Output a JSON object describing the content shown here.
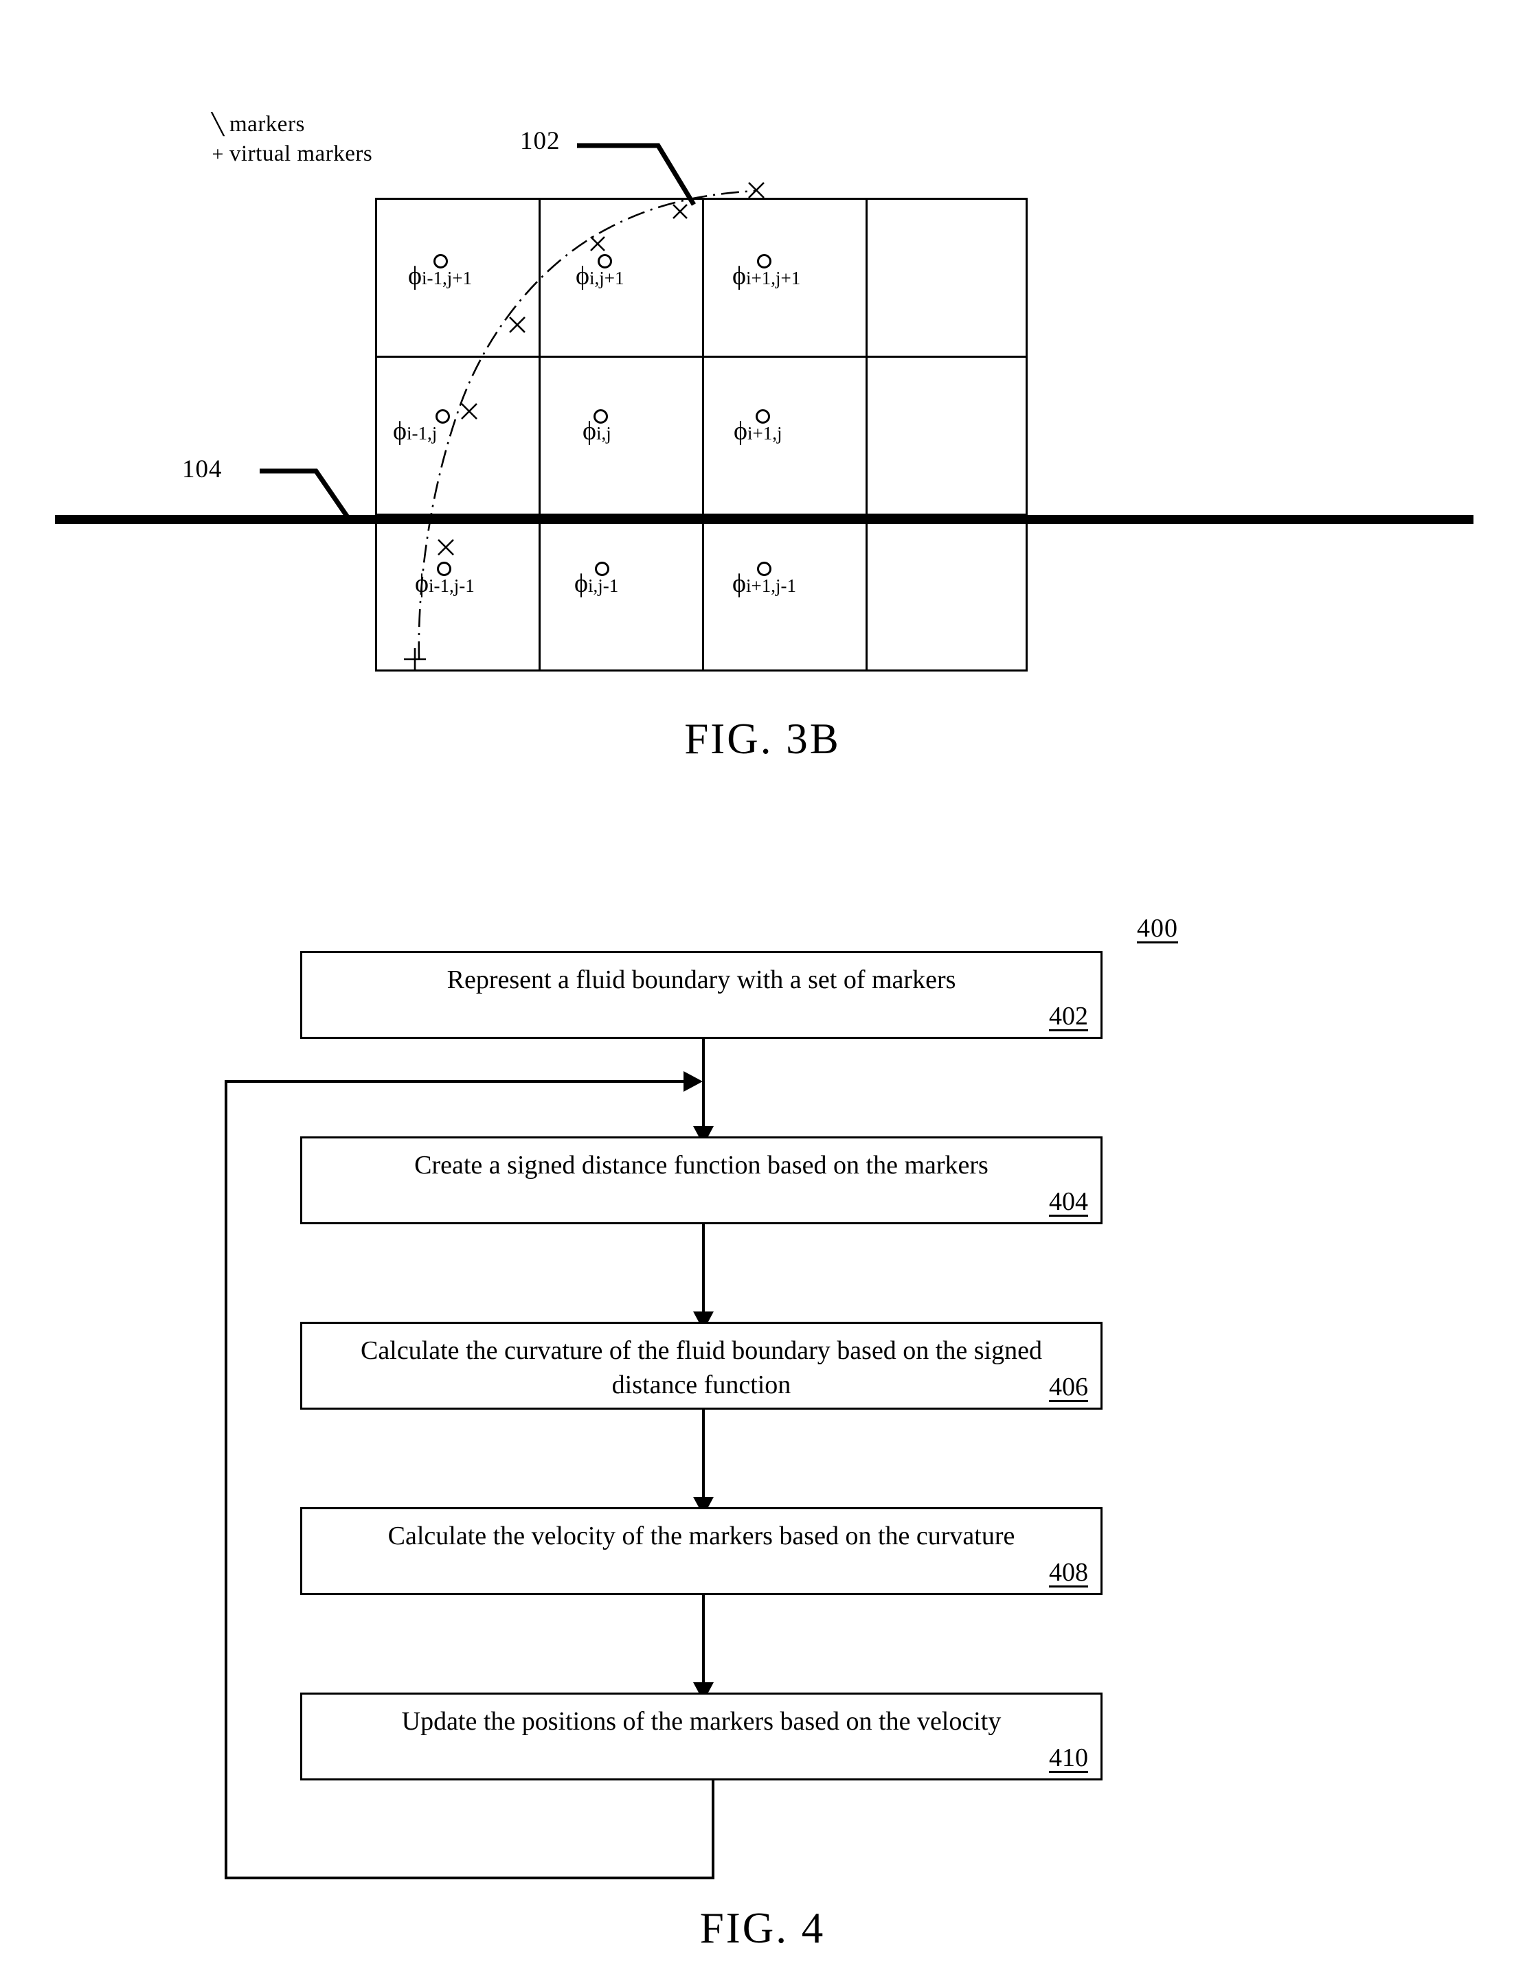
{
  "figure_3b": {
    "caption": "FIG. 3B",
    "legend": [
      {
        "symbol": "╲",
        "symbol_name": "diagonal-tick",
        "label": "markers"
      },
      {
        "symbol": "+",
        "symbol_name": "plus",
        "label": "virtual markers"
      }
    ],
    "callouts": [
      {
        "id": "102",
        "points_to": "fluid-boundary-curve"
      },
      {
        "id": "104",
        "points_to": "horizontal-reference-line"
      }
    ],
    "grid": {
      "columns": 4,
      "rows": 3,
      "cells": [
        {
          "row": 0,
          "col": 0,
          "phi": "ϕ",
          "subscript": "i-1,j+1"
        },
        {
          "row": 0,
          "col": 1,
          "phi": "ϕ",
          "subscript": "i,j+1"
        },
        {
          "row": 0,
          "col": 2,
          "phi": "ϕ",
          "subscript": "i+1,j+1"
        },
        {
          "row": 0,
          "col": 3,
          "phi": "",
          "subscript": ""
        },
        {
          "row": 1,
          "col": 0,
          "phi": "ϕ",
          "subscript": "i-1,j"
        },
        {
          "row": 1,
          "col": 1,
          "phi": "ϕ",
          "subscript": "i,j"
        },
        {
          "row": 1,
          "col": 2,
          "phi": "ϕ",
          "subscript": "i+1,j"
        },
        {
          "row": 1,
          "col": 3,
          "phi": "",
          "subscript": ""
        },
        {
          "row": 2,
          "col": 0,
          "phi": "ϕ",
          "subscript": "i-1,j-1"
        },
        {
          "row": 2,
          "col": 1,
          "phi": "ϕ",
          "subscript": "i,j-1"
        },
        {
          "row": 2,
          "col": 2,
          "phi": "ϕ",
          "subscript": "i+1,j-1"
        },
        {
          "row": 2,
          "col": 3,
          "phi": "",
          "subscript": ""
        }
      ]
    }
  },
  "figure_4": {
    "caption": "FIG. 4",
    "flow_id": "400",
    "steps": [
      {
        "number": "402",
        "text": "Represent a fluid boundary with a set of markers"
      },
      {
        "number": "404",
        "text": "Create a signed distance function based on the markers"
      },
      {
        "number": "406",
        "text": "Calculate the curvature of the fluid boundary based on the signed distance function"
      },
      {
        "number": "408",
        "text": "Calculate the velocity of the markers based on the curvature"
      },
      {
        "number": "410",
        "text": "Update the positions of the markers based on the velocity"
      }
    ]
  }
}
